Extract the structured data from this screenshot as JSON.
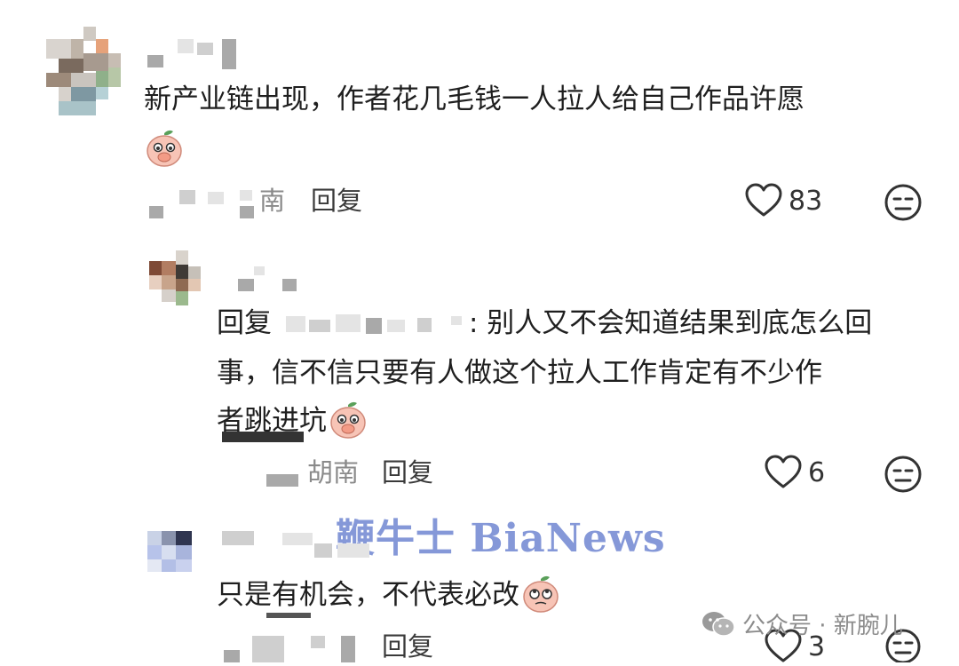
{
  "comments": [
    {
      "text_line1": "新产业链出现，作者花几毛钱一人拉人给自己作品许愿",
      "location_partial": "南",
      "reply_label": "回复",
      "likes": "83"
    },
    {
      "reply_prefix": "回复",
      "text_after_mention": ": 别人又不会知道结果到底怎么回",
      "text_line2": "事，信不信只要有人做这个拉人工作肯定有不少作",
      "text_line3": "者跳进坑",
      "location": "胡南",
      "reply_label": "回复",
      "likes": "6"
    },
    {
      "text_line1": "只是有机会，不代表必改",
      "reply_label": "回复",
      "likes": "3"
    }
  ],
  "watermark": "鞭牛士 BiaNews",
  "source": {
    "label": "公众号 · 新腕儿",
    "icon": "wechat-icon"
  },
  "colors": {
    "watermark": "#7f93d6",
    "text": "#1f1f1f",
    "meta": "#8a8a8a"
  }
}
